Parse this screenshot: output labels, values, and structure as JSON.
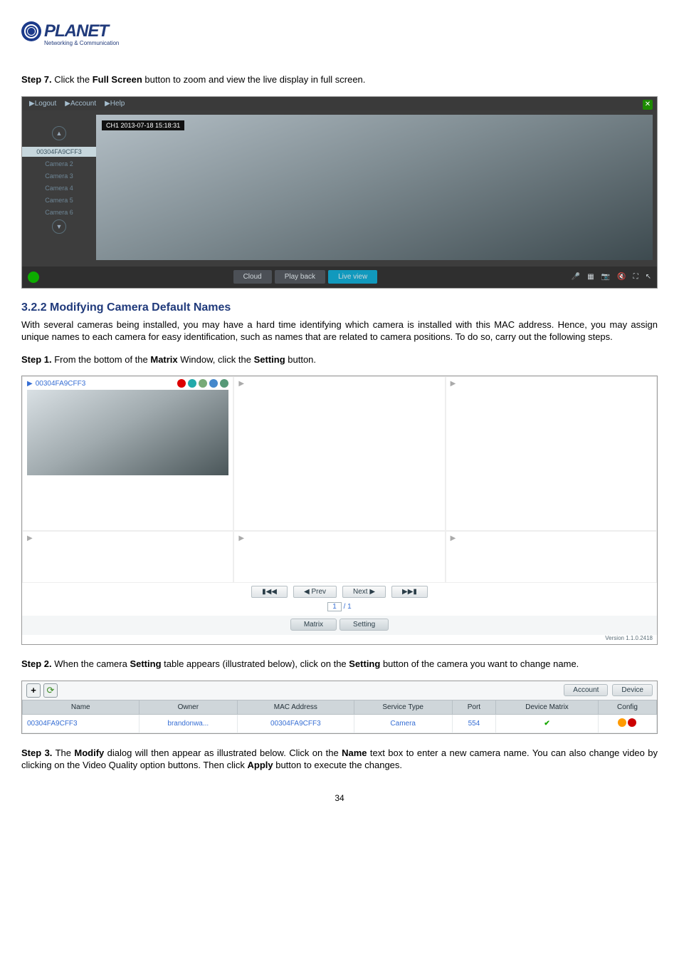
{
  "logo": {
    "name": "PLANET",
    "tag": "Networking & Communication"
  },
  "step7": "Step 7. Click the Full Screen button to zoom and view the live display in full screen.",
  "fig1": {
    "topbar": [
      "▶Logout",
      "▶Account",
      "▶Help"
    ],
    "active_cam": "00304FA9CFF3",
    "cams": [
      "Camera 2",
      "Camera 3",
      "Camera 4",
      "Camera 5",
      "Camera 6"
    ],
    "timestamp": "CH1 2013-07-18 15:18:31",
    "bottom_tabs": [
      "Cloud",
      "Play back",
      "Live view"
    ]
  },
  "section_title": "3.2.2 Modifying Camera Default Names",
  "section_para": "With several cameras being installed, you may have a hard time identifying which camera is installed with this MAC address. Hence, you may assign unique names to each camera for easy identification, such as names that are related to camera positions. To do so, carry out the following steps.",
  "step1": "Step 1. From the bottom of the Matrix Window, click the Setting button.",
  "fig2": {
    "cam_label": "00304FA9CFF3",
    "nav": {
      "first": "▮◀◀",
      "prev": "◀ Prev",
      "next": "Next ▶",
      "last": "▶▶▮"
    },
    "page_cur": "1",
    "page_tot": "/ 1",
    "tabs": [
      "Matrix",
      "Setting"
    ],
    "version": "Version 1.1.0.2418"
  },
  "step2": "Step 2. When the camera Setting table appears (illustrated below), click on the Setting button of the camera you want to change name.",
  "fig3": {
    "right_tabs": [
      "Account",
      "Device"
    ],
    "headers": [
      "Name",
      "Owner",
      "MAC Address",
      "Service Type",
      "Port",
      "Device Matrix",
      "Config"
    ],
    "row": {
      "name": "00304FA9CFF3",
      "owner": "brandonwa...",
      "mac": "00304FA9CFF3",
      "svc": "Camera",
      "port": "554"
    }
  },
  "step3": "Step 3. The Modify dialog will then appear as illustrated below. Click on the Name text box to enter a new camera name. You can also change video by clicking on the Video Quality option buttons. Then click Apply button to execute the changes.",
  "page_number": "34"
}
